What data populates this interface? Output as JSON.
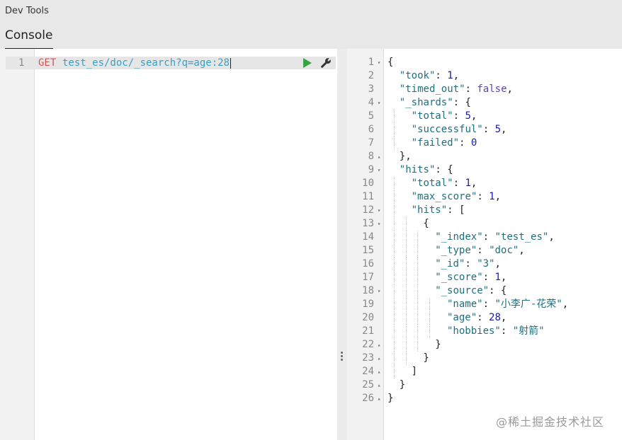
{
  "app": {
    "title": "Dev Tools"
  },
  "tabs": [
    {
      "label": "Console"
    }
  ],
  "request": {
    "line_number": "1",
    "method": "GET",
    "url": "test_es/doc/_search?q=age:28"
  },
  "toolbar": {
    "run_icon": "play-icon",
    "settings_icon": "wrench-icon"
  },
  "response": {
    "lines": [
      {
        "num": "1",
        "fold": "▾",
        "indent": 0,
        "tokens": [
          [
            "p",
            "{"
          ]
        ]
      },
      {
        "num": "2",
        "fold": "",
        "indent": 1,
        "tokens": [
          [
            "k",
            "\"took\""
          ],
          [
            "p",
            ": "
          ],
          [
            "n",
            "1"
          ],
          [
            "p",
            ","
          ]
        ]
      },
      {
        "num": "3",
        "fold": "",
        "indent": 1,
        "tokens": [
          [
            "k",
            "\"timed_out\""
          ],
          [
            "p",
            ": "
          ],
          [
            "b",
            "false"
          ],
          [
            "p",
            ","
          ]
        ]
      },
      {
        "num": "4",
        "fold": "▾",
        "indent": 1,
        "tokens": [
          [
            "k",
            "\"_shards\""
          ],
          [
            "p",
            ": {"
          ]
        ]
      },
      {
        "num": "5",
        "fold": "",
        "indent": 2,
        "tokens": [
          [
            "k",
            "\"total\""
          ],
          [
            "p",
            ": "
          ],
          [
            "n",
            "5"
          ],
          [
            "p",
            ","
          ]
        ]
      },
      {
        "num": "6",
        "fold": "",
        "indent": 2,
        "tokens": [
          [
            "k",
            "\"successful\""
          ],
          [
            "p",
            ": "
          ],
          [
            "n",
            "5"
          ],
          [
            "p",
            ","
          ]
        ]
      },
      {
        "num": "7",
        "fold": "",
        "indent": 2,
        "tokens": [
          [
            "k",
            "\"failed\""
          ],
          [
            "p",
            ": "
          ],
          [
            "n",
            "0"
          ]
        ]
      },
      {
        "num": "8",
        "fold": "▴",
        "indent": 1,
        "tokens": [
          [
            "p",
            "},"
          ]
        ]
      },
      {
        "num": "9",
        "fold": "▾",
        "indent": 1,
        "tokens": [
          [
            "k",
            "\"hits\""
          ],
          [
            "p",
            ": {"
          ]
        ]
      },
      {
        "num": "10",
        "fold": "",
        "indent": 2,
        "tokens": [
          [
            "k",
            "\"total\""
          ],
          [
            "p",
            ": "
          ],
          [
            "n",
            "1"
          ],
          [
            "p",
            ","
          ]
        ]
      },
      {
        "num": "11",
        "fold": "",
        "indent": 2,
        "tokens": [
          [
            "k",
            "\"max_score\""
          ],
          [
            "p",
            ": "
          ],
          [
            "n",
            "1"
          ],
          [
            "p",
            ","
          ]
        ]
      },
      {
        "num": "12",
        "fold": "▾",
        "indent": 2,
        "tokens": [
          [
            "k",
            "\"hits\""
          ],
          [
            "p",
            ": ["
          ]
        ]
      },
      {
        "num": "13",
        "fold": "▾",
        "indent": 3,
        "tokens": [
          [
            "p",
            "{"
          ]
        ]
      },
      {
        "num": "14",
        "fold": "",
        "indent": 4,
        "tokens": [
          [
            "k",
            "\"_index\""
          ],
          [
            "p",
            ": "
          ],
          [
            "s",
            "\"test_es\""
          ],
          [
            "p",
            ","
          ]
        ]
      },
      {
        "num": "15",
        "fold": "",
        "indent": 4,
        "tokens": [
          [
            "k",
            "\"_type\""
          ],
          [
            "p",
            ": "
          ],
          [
            "s",
            "\"doc\""
          ],
          [
            "p",
            ","
          ]
        ]
      },
      {
        "num": "16",
        "fold": "",
        "indent": 4,
        "tokens": [
          [
            "k",
            "\"_id\""
          ],
          [
            "p",
            ": "
          ],
          [
            "s",
            "\"3\""
          ],
          [
            "p",
            ","
          ]
        ]
      },
      {
        "num": "17",
        "fold": "",
        "indent": 4,
        "tokens": [
          [
            "k",
            "\"_score\""
          ],
          [
            "p",
            ": "
          ],
          [
            "n",
            "1"
          ],
          [
            "p",
            ","
          ]
        ]
      },
      {
        "num": "18",
        "fold": "▾",
        "indent": 4,
        "tokens": [
          [
            "k",
            "\"_source\""
          ],
          [
            "p",
            ": {"
          ]
        ]
      },
      {
        "num": "19",
        "fold": "",
        "indent": 5,
        "tokens": [
          [
            "k",
            "\"name\""
          ],
          [
            "p",
            ": "
          ],
          [
            "s",
            "\"小李广-花荣\""
          ],
          [
            "p",
            ","
          ]
        ]
      },
      {
        "num": "20",
        "fold": "",
        "indent": 5,
        "tokens": [
          [
            "k",
            "\"age\""
          ],
          [
            "p",
            ": "
          ],
          [
            "n",
            "28"
          ],
          [
            "p",
            ","
          ]
        ]
      },
      {
        "num": "21",
        "fold": "",
        "indent": 5,
        "tokens": [
          [
            "k",
            "\"hobbies\""
          ],
          [
            "p",
            ": "
          ],
          [
            "s",
            "\"射箭\""
          ]
        ]
      },
      {
        "num": "22",
        "fold": "▴",
        "indent": 4,
        "tokens": [
          [
            "p",
            "}"
          ]
        ]
      },
      {
        "num": "23",
        "fold": "▴",
        "indent": 3,
        "tokens": [
          [
            "p",
            "}"
          ]
        ]
      },
      {
        "num": "24",
        "fold": "▴",
        "indent": 2,
        "tokens": [
          [
            "p",
            "]"
          ]
        ]
      },
      {
        "num": "25",
        "fold": "▴",
        "indent": 1,
        "tokens": [
          [
            "p",
            "}"
          ]
        ]
      },
      {
        "num": "26",
        "fold": "▴",
        "indent": 0,
        "tokens": [
          [
            "p",
            "}"
          ]
        ]
      }
    ]
  },
  "watermark": "@稀土掘金技术社区"
}
